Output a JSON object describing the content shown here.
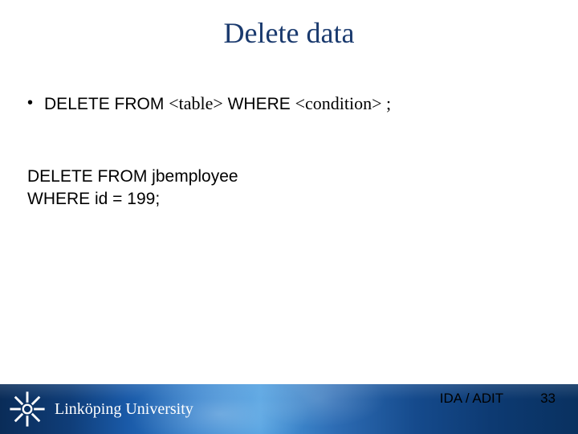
{
  "title": "Delete data",
  "bullet": {
    "marker": "•",
    "text_prefix": "DELETE FROM ",
    "placeholder1": "<table>",
    "mid": " WHERE ",
    "placeholder2": "<condition>",
    "suffix": " ;"
  },
  "example": {
    "line1": "DELETE FROM jbemployee",
    "line2": "WHERE id = 199;"
  },
  "footer": {
    "university": "Linköping University",
    "department": "IDA / ADIT",
    "page_number": "33"
  }
}
